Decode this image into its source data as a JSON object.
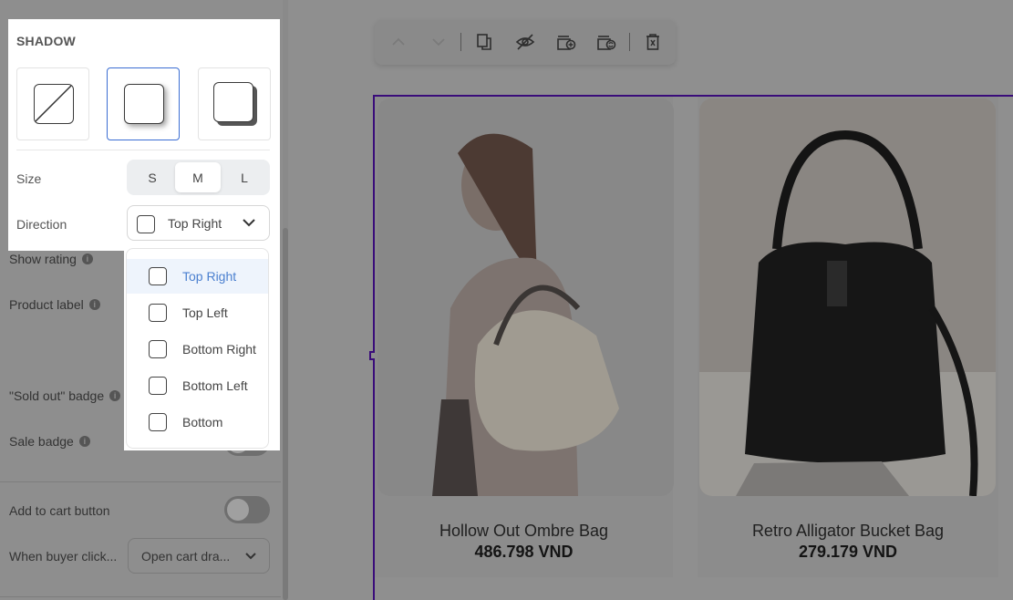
{
  "sidebar": {
    "rows": [
      {
        "label": "Show rating"
      },
      {
        "label": "Product label"
      },
      {
        "label": "\"Sold out\" badge"
      },
      {
        "label": "Sale badge"
      }
    ],
    "add_to_cart": {
      "label": "Add to cart button",
      "enabled": false
    },
    "when_buyer": {
      "label": "When buyer click...",
      "value": "Open cart dra..."
    }
  },
  "shadow_panel": {
    "title": "SHADOW",
    "styles": [
      {
        "icon": "no-shadow-icon",
        "selected": false
      },
      {
        "icon": "soft-shadow-icon",
        "selected": true
      },
      {
        "icon": "hard-shadow-icon",
        "selected": false
      }
    ],
    "size": {
      "label": "Size",
      "options": [
        "S",
        "M",
        "L"
      ],
      "selected": "M"
    },
    "direction": {
      "label": "Direction",
      "value": "Top Right",
      "options": [
        "Top Right",
        "Top Left",
        "Bottom Right",
        "Bottom Left",
        "Bottom"
      ],
      "selected": "Top Right"
    }
  },
  "toolbar": {
    "icons": [
      "chevron-up-icon",
      "chevron-down-icon",
      "duplicate-icon",
      "hide-icon",
      "add-section-icon",
      "swap-icon",
      "delete-icon"
    ]
  },
  "products": [
    {
      "name": "Hollow Out Ombre Bag",
      "price": "486.798 VND"
    },
    {
      "name": "Retro Alligator Bucket Bag",
      "price": "279.179 VND"
    }
  ],
  "colors": {
    "accent": "#3b6ed3",
    "selection": "#3a0c7a",
    "selected_text": "#4a7fcf"
  }
}
